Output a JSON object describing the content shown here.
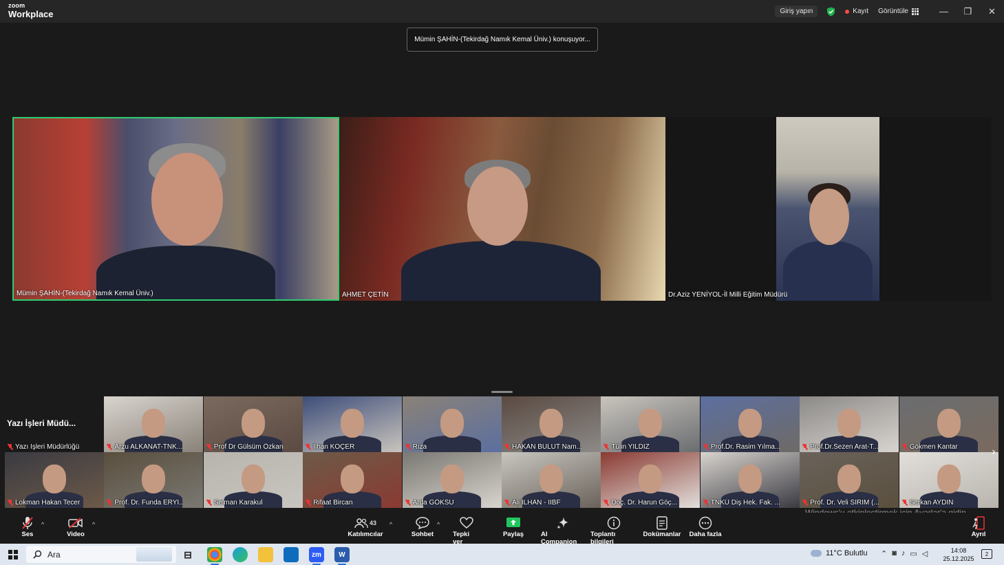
{
  "titlebar": {
    "logo_top": "zoom",
    "logo_bottom": "Workplace",
    "signin_label": "Giriş yapın",
    "record_label": "Kayıt",
    "view_label": "Görüntüle",
    "minimize": "—",
    "restore": "❐",
    "close": "✕"
  },
  "speaking_banner": "Mümin ŞAHİN-(Tekirdağ Namık Kemal Üniv.) konuşuyor...",
  "stage": [
    {
      "name": "Mümin ŞAHİN-(Tekirdağ Namık Kemal Üniv.)",
      "active_speaker": true
    },
    {
      "name": "AHMET ÇETİN",
      "active_speaker": false
    },
    {
      "name": "Dr.Aziz YENİYOL-İl Milli Eğitim Müdürü",
      "active_speaker": false
    }
  ],
  "gallery": {
    "label": "Yazı İşleri Müdü...",
    "row1": [
      {
        "name": "Yazı İşleri Müdürlüğü"
      },
      {
        "name": "Arzu ALKANAT-TNK..."
      },
      {
        "name": "Prof Dr Gülsüm Özkan"
      },
      {
        "name": "İlhan KOÇER"
      },
      {
        "name": "Rıza"
      },
      {
        "name": "HAKAN BULUT Nam..."
      },
      {
        "name": "Tülin YILDIZ"
      },
      {
        "name": "Prof.Dr. Rasim Yılma..."
      },
      {
        "name": "Prof.Dr.Sezen Arat-T..."
      },
      {
        "name": "Gökmen Kantar"
      }
    ],
    "row2": [
      {
        "name": "Lokman Hakan Tecer"
      },
      {
        "name": "Prof. Dr. Funda ERYI..."
      },
      {
        "name": "Selman Karakul"
      },
      {
        "name": "Rifaat Bircan"
      },
      {
        "name": "Arda GÖKSU"
      },
      {
        "name": "Ali İLHAN - İİBF"
      },
      {
        "name": "Doç. Dr. Harun Göç..."
      },
      {
        "name": "TNKÜ Diş Hek. Fak. ..."
      },
      {
        "name": "Prof. Dr. Veli SIRIM (..."
      },
      {
        "name": "Serkan AYDIN"
      }
    ],
    "next_arrow": "›"
  },
  "watermark": "Windows'u etkinleştirmek için Ayarlar'a gidin.",
  "toolbar": {
    "audio": "Ses",
    "video": "Video",
    "participants": "Katılımcılar",
    "participants_count": "43",
    "chat": "Sohbet",
    "react": "Tepki ver",
    "share": "Paylaş",
    "ai": "AI Companion",
    "info": "Toplantı bilgileri",
    "docs": "Dokümanlar",
    "more": "Daha fazla",
    "leave": "Ayrıl",
    "caret": "^"
  },
  "taskbar": {
    "search_placeholder": "Ara",
    "weather": "11°C  Bulutlu",
    "time": "14:08",
    "date": "25.12.2025",
    "notif_count": "2"
  },
  "colors": {
    "active_speaker_border": "#2ecc71",
    "share_green": "#21c55d",
    "background": "#1a1a1a"
  }
}
